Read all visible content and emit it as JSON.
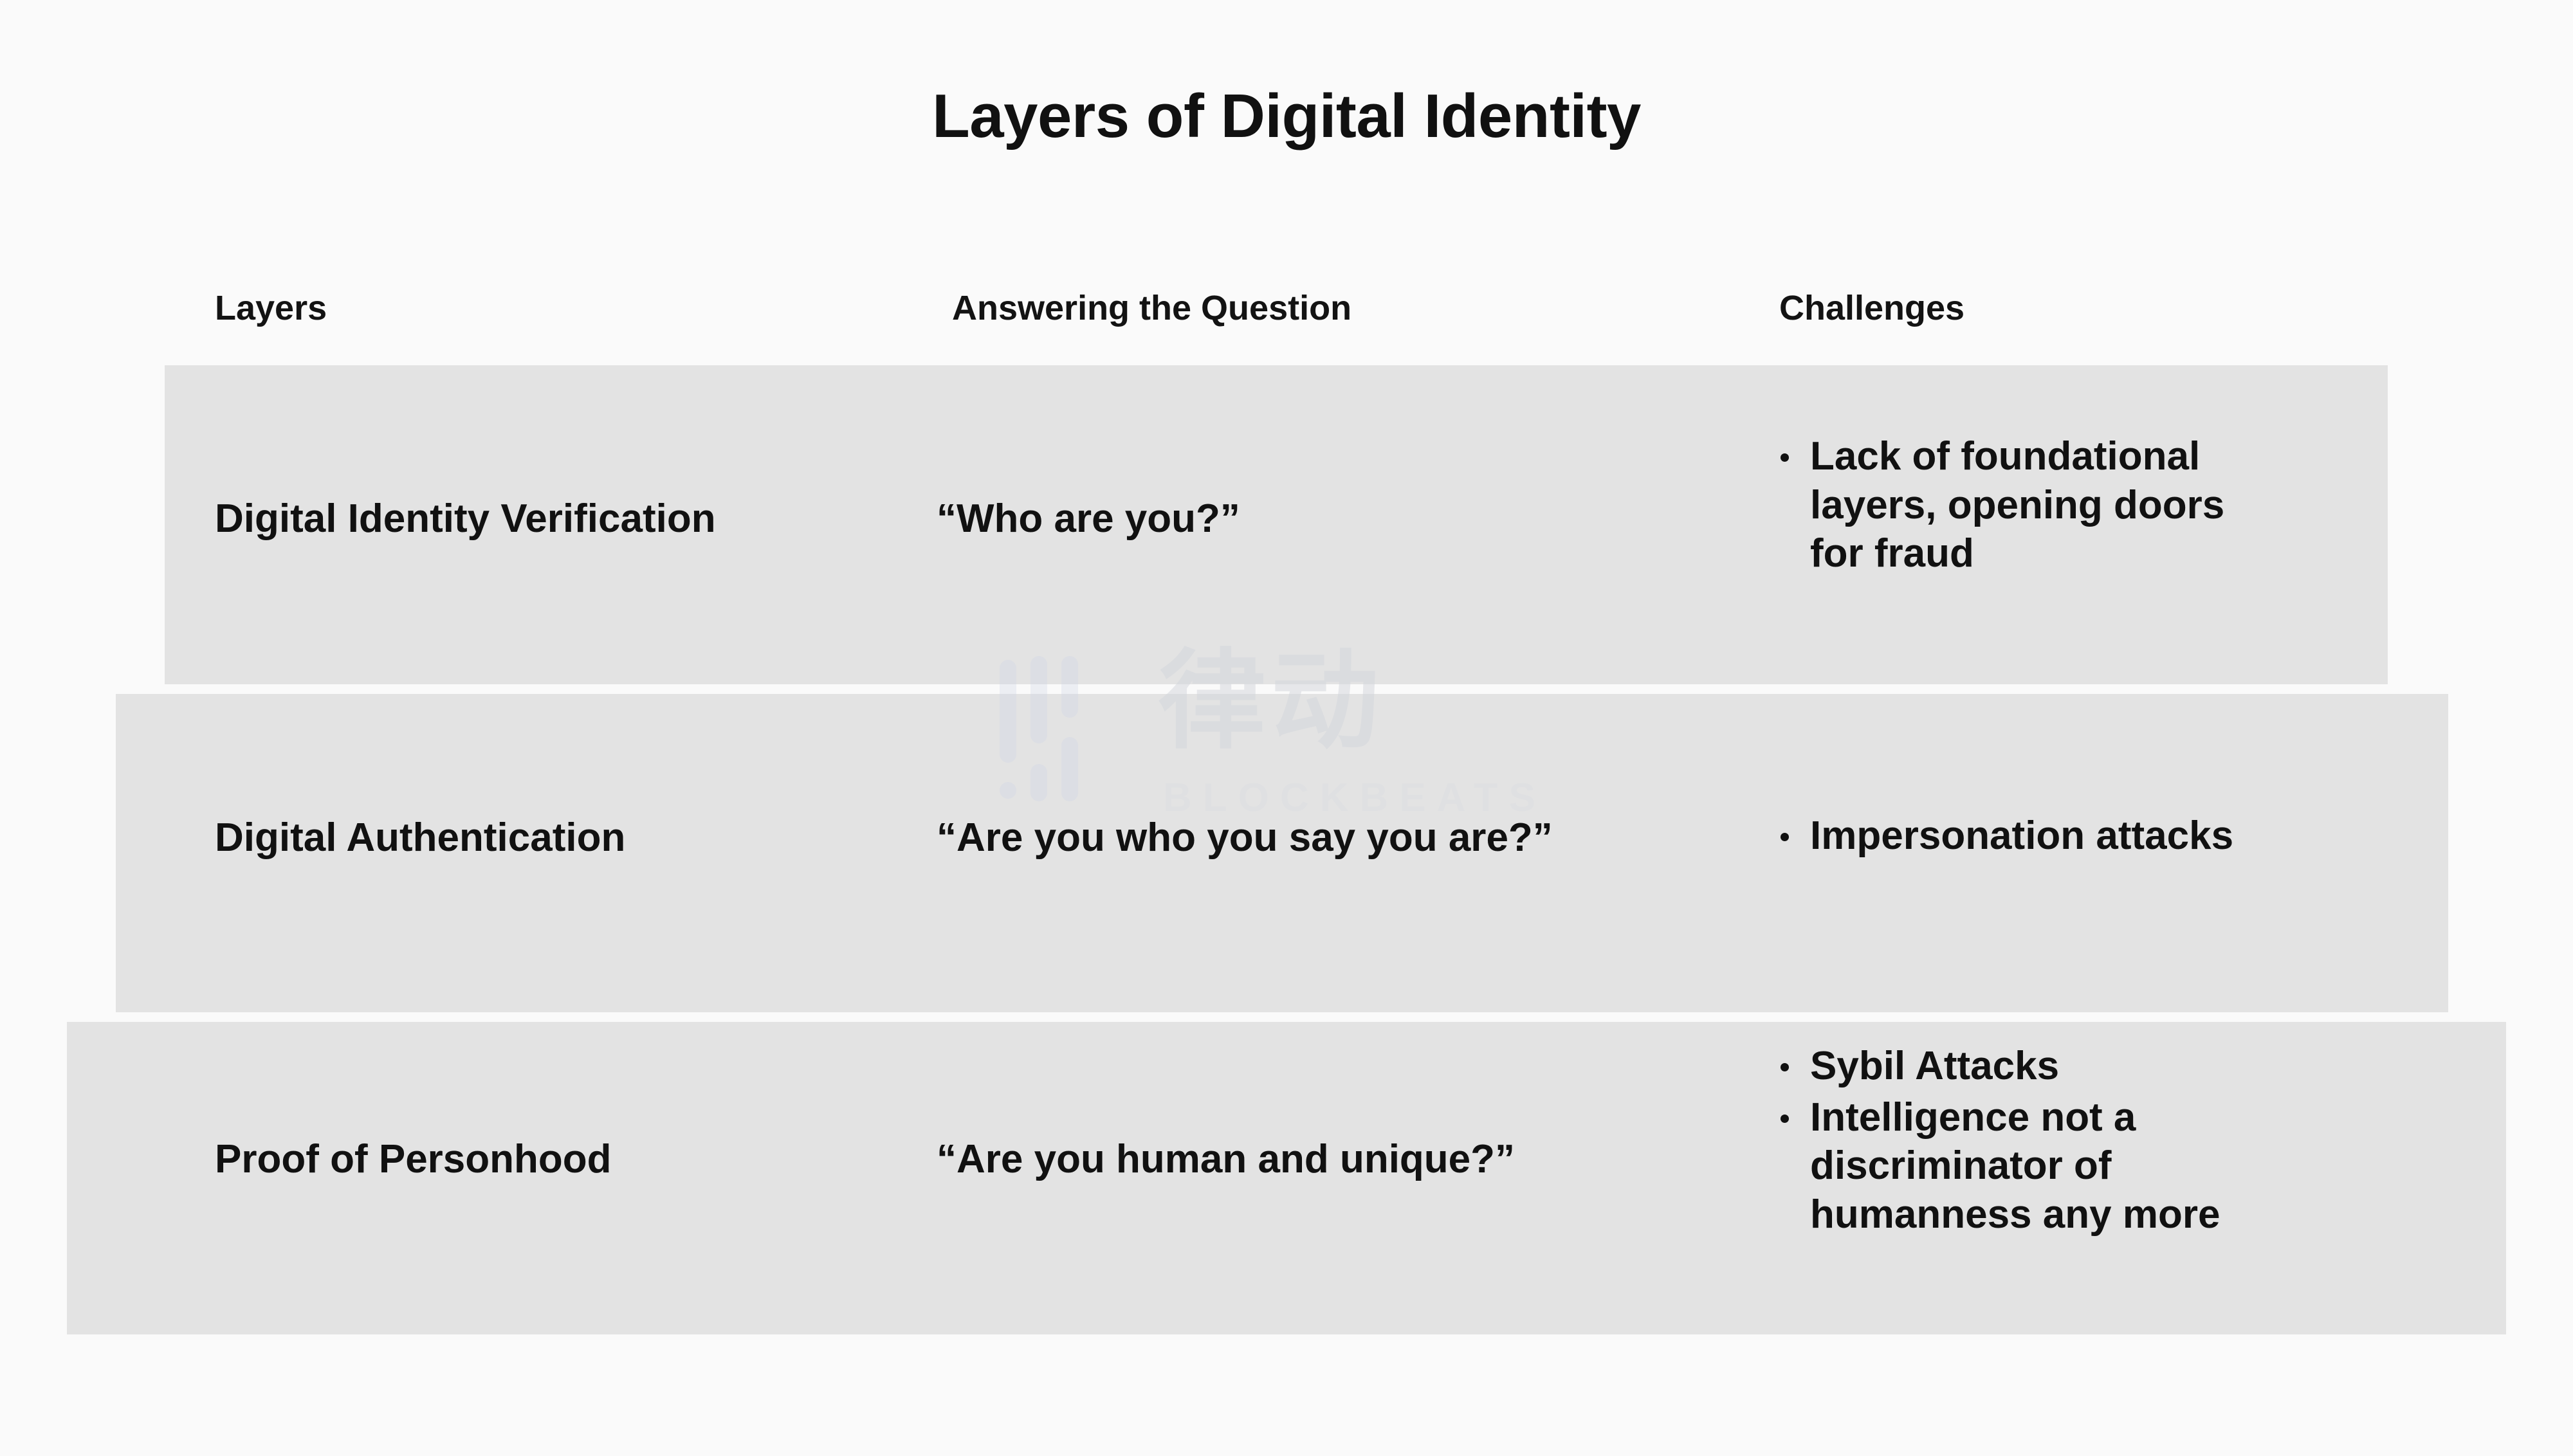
{
  "title": "Layers of Digital Identity",
  "columns": {
    "layers": "Layers",
    "question": "Answering the Question",
    "challenges": "Challenges"
  },
  "rows": [
    {
      "layer": "Digital Identity Verification",
      "question": "“Who are you?”",
      "challenges": [
        "Lack of foundational layers, opening doors for fraud"
      ]
    },
    {
      "layer": "Digital Authentication",
      "question": "“Are you who you say you are?”",
      "challenges": [
        "Impersonation attacks"
      ]
    },
    {
      "layer": "Proof of Personhood",
      "question": "“Are you human and unique?”",
      "challenges": [
        "Sybil Attacks",
        "Intelligence not a discriminator of humanness any more"
      ]
    }
  ],
  "watermark": {
    "cn_text": "律动",
    "en_text": "BLOCKBEATS"
  },
  "colors": {
    "background": "#fafafa",
    "band": "#e3e3e3",
    "text": "#111111",
    "watermark_bar": "#ccd4e4",
    "watermark_text": "#d3d6dc"
  }
}
